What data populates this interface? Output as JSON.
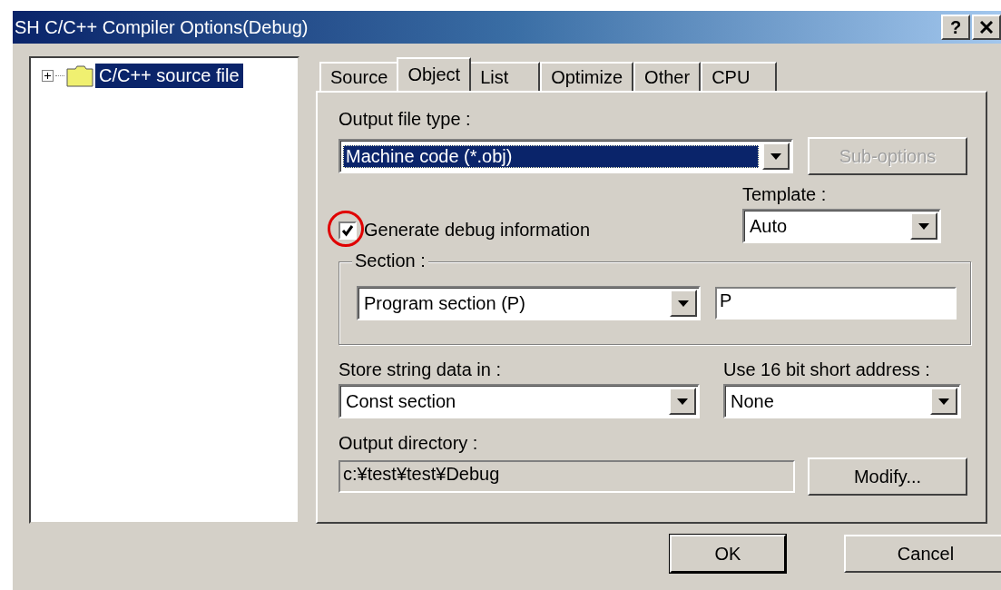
{
  "window": {
    "title": "SH C/C++ Compiler Options(Debug)"
  },
  "title_buttons": [
    {
      "kind": "help",
      "label": "?"
    },
    {
      "kind": "close"
    }
  ],
  "tree": [
    {
      "label": "C/C++ source file",
      "expanded": false,
      "selected": true
    }
  ],
  "tabs": [
    {
      "label": "Source",
      "selected": false
    },
    {
      "label": "Object",
      "selected": true
    },
    {
      "label": "List",
      "selected": false
    },
    {
      "label": "Optimize",
      "selected": false
    },
    {
      "label": "Other",
      "selected": false
    },
    {
      "label": "CPU",
      "selected": false
    }
  ],
  "output_file_type": {
    "label": "Output file type :",
    "value": "Machine code (*.obj)",
    "focused": true
  },
  "sub_options_button": {
    "label": "Sub-options",
    "disabled": true
  },
  "template": {
    "label": "Template :",
    "value": "Auto"
  },
  "debug_checkbox": {
    "label": "Generate debug information",
    "checked": true,
    "annotated": true
  },
  "section": {
    "label": "Section :",
    "dropdown_value": "Program section (P)",
    "name_value": "P"
  },
  "store_string": {
    "label": "Store string data in :",
    "value": "Const section"
  },
  "short_address": {
    "label": "Use 16 bit short address :",
    "value": "None"
  },
  "output_directory": {
    "label": "Output directory :",
    "value": "c:¥test¥test¥Debug",
    "read_only": true
  },
  "modify_button": {
    "label": "Modify..."
  },
  "buttons": [
    {
      "label": "OK",
      "default": true
    },
    {
      "label": "Cancel",
      "default": false
    }
  ]
}
